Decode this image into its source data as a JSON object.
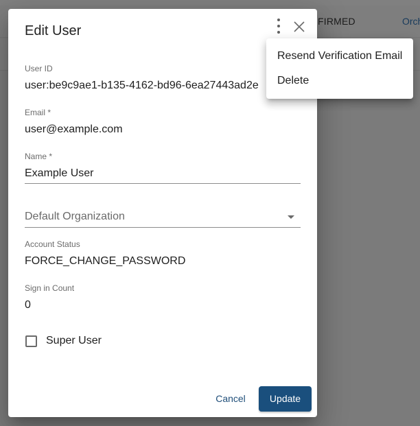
{
  "background": {
    "status_text": "FIRMED",
    "link_text": "Orch"
  },
  "dialog": {
    "title": "Edit User",
    "fields": {
      "user_id": {
        "label": "User ID",
        "value": "user:be9c9ae1-b135-4162-bd96-6ea27443ad2e"
      },
      "email": {
        "label": "Email *",
        "value": "user@example.com"
      },
      "name": {
        "label": "Name *",
        "value": "Example User"
      },
      "default_organization": {
        "placeholder": "Default Organization"
      },
      "account_status": {
        "label": "Account Status",
        "value": "FORCE_CHANGE_PASSWORD"
      },
      "sign_in_count": {
        "label": "Sign in Count",
        "value": "0"
      }
    },
    "super_user": {
      "label": "Super User",
      "checked": false
    },
    "actions": {
      "cancel": "Cancel",
      "update": "Update"
    }
  },
  "menu": {
    "items": [
      {
        "label": "Resend Verification Email"
      },
      {
        "label": "Delete"
      }
    ]
  },
  "colors": {
    "primary": "#1a4f7d",
    "link": "#1f4e79",
    "overlay": "#7b7b7b"
  },
  "icons": [
    "more-vert-icon",
    "close-icon",
    "dropdown-arrow-icon",
    "checkbox-icon"
  ]
}
